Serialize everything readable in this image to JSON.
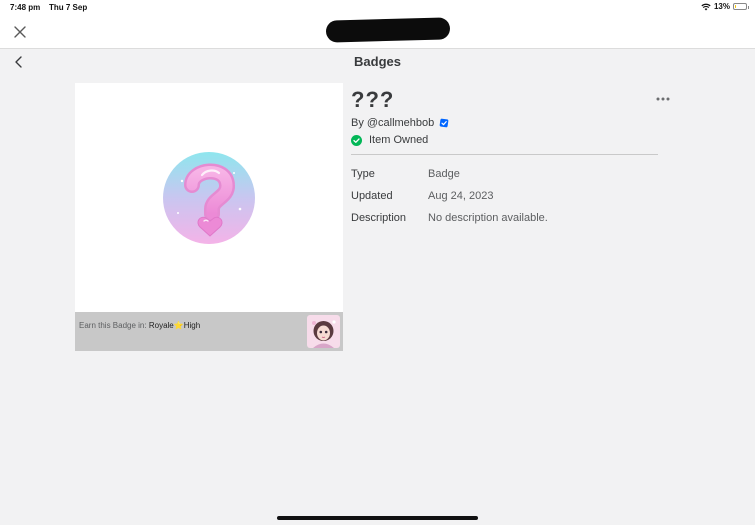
{
  "status_bar": {
    "time": "7:48 pm",
    "date": "Thu 7 Sep",
    "battery": "13%",
    "battery_level": 0.13
  },
  "top_bar": {
    "close_icon": "close-icon"
  },
  "nav": {
    "title": "Badges",
    "back_icon": "chevron-left-icon"
  },
  "badge": {
    "name": "???",
    "by_label": "By",
    "creator": "@callmehbob",
    "owned_label": "Item Owned",
    "details": [
      {
        "key": "Type",
        "value": "Badge"
      },
      {
        "key": "Updated",
        "value": "Aug 24, 2023"
      },
      {
        "key": "Description",
        "value": "No description available."
      }
    ]
  },
  "earn": {
    "label": "Earn this Badge in:",
    "game_part1": "Royale",
    "game_star": "⭐",
    "game_part2": "High"
  },
  "colors": {
    "background": "#f2f2f3",
    "owned_green": "#02b757",
    "verified_blue": "#0066ff",
    "earn_bar": "#c8c8c8"
  }
}
